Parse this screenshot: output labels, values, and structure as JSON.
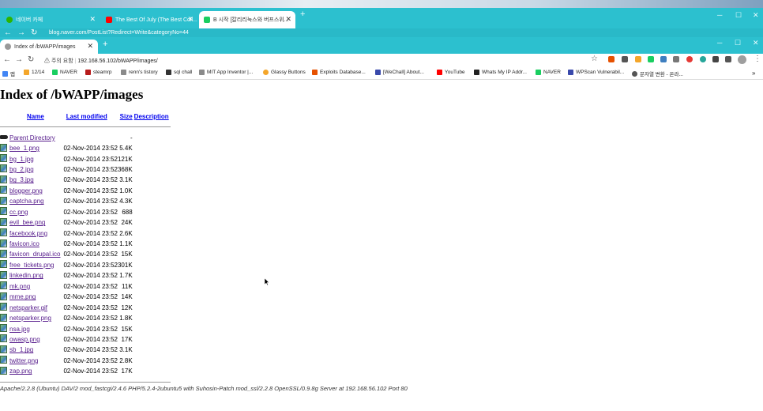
{
  "back_window": {
    "tabs": [
      {
        "title": "네이버 카페",
        "color": "#2db400"
      },
      {
        "title": "The Best Of July (The Best Coll...",
        "color": "#ff0000"
      },
      {
        "title": "B 시작 [칼리리눅스와 버프스위...",
        "color": "#19ce60"
      }
    ],
    "url": "blog.naver.com/PostList?Redirect=Write&categoryNo=44"
  },
  "front_window": {
    "tab_title": "Index of /bWAPP/images",
    "url_warning": "주의 요함",
    "url": "192.168.56.102/bWAPP/images/",
    "bookmarks": [
      {
        "label": "앱",
        "color": "#4285f4"
      },
      {
        "label": "12/14",
        "color": "#f4a62a"
      },
      {
        "label": "NAVER",
        "color": "#19ce60"
      },
      {
        "label": "steamrp",
        "color": "#b71c1c"
      },
      {
        "label": "renn's tistory",
        "color": "#8a8a8a"
      },
      {
        "label": "sql chall",
        "color": "#333333"
      },
      {
        "label": "MIT App Inventor |...",
        "color": "#8a8a8a"
      },
      {
        "label": "Glassy Buttons",
        "color": "#f4a62a"
      },
      {
        "label": "Exploits Database...",
        "color": "#e65100"
      },
      {
        "label": "[WeChall] About...",
        "color": "#3949ab"
      },
      {
        "label": "YouTube",
        "color": "#ff0000"
      },
      {
        "label": "Whats My IP Addr...",
        "color": "#222222"
      },
      {
        "label": "NAVER",
        "color": "#19ce60"
      },
      {
        "label": "WPScan Vulnerabil...",
        "color": "#3949ab"
      },
      {
        "label": "문자열 변환 - 온라...",
        "color": "#555555"
      }
    ]
  },
  "page": {
    "title": "Index of /bWAPP/images",
    "headers": {
      "name": "Name",
      "modified": "Last modified",
      "size": "Size",
      "description": "Description"
    },
    "parent": {
      "name": "Parent Directory",
      "size": "-"
    },
    "files": [
      {
        "name": "bee_1.png",
        "modified": "02-Nov-2014 23:52",
        "size": "5.4K"
      },
      {
        "name": "bg_1.jpg",
        "modified": "02-Nov-2014 23:52",
        "size": "121K"
      },
      {
        "name": "bg_2.jpg",
        "modified": "02-Nov-2014 23:52",
        "size": "368K"
      },
      {
        "name": "bg_3.jpg",
        "modified": "02-Nov-2014 23:52",
        "size": "3.1K"
      },
      {
        "name": "blogger.png",
        "modified": "02-Nov-2014 23:52",
        "size": "1.0K"
      },
      {
        "name": "captcha.png",
        "modified": "02-Nov-2014 23:52",
        "size": "4.3K"
      },
      {
        "name": "cc.png",
        "modified": "02-Nov-2014 23:52",
        "size": "688"
      },
      {
        "name": "evil_bee.png",
        "modified": "02-Nov-2014 23:52",
        "size": "24K"
      },
      {
        "name": "facebook.png",
        "modified": "02-Nov-2014 23:52",
        "size": "2.6K"
      },
      {
        "name": "favicon.ico",
        "modified": "02-Nov-2014 23:52",
        "size": "1.1K"
      },
      {
        "name": "favicon_drupal.ico",
        "modified": "02-Nov-2014 23:52",
        "size": "15K"
      },
      {
        "name": "free_tickets.png",
        "modified": "02-Nov-2014 23:52",
        "size": "301K"
      },
      {
        "name": "linkedin.png",
        "modified": "02-Nov-2014 23:52",
        "size": "1.7K"
      },
      {
        "name": "mk.png",
        "modified": "02-Nov-2014 23:52",
        "size": "11K"
      },
      {
        "name": "mme.png",
        "modified": "02-Nov-2014 23:52",
        "size": "14K"
      },
      {
        "name": "netsparker.gif",
        "modified": "02-Nov-2014 23:52",
        "size": "12K"
      },
      {
        "name": "netsparker.png",
        "modified": "02-Nov-2014 23:52",
        "size": "1.8K"
      },
      {
        "name": "nsa.jpg",
        "modified": "02-Nov-2014 23:52",
        "size": "15K"
      },
      {
        "name": "owasp.png",
        "modified": "02-Nov-2014 23:52",
        "size": "17K"
      },
      {
        "name": "sb_1.jpg",
        "modified": "02-Nov-2014 23:52",
        "size": "3.1K"
      },
      {
        "name": "twitter.png",
        "modified": "02-Nov-2014 23:52",
        "size": "2.8K"
      },
      {
        "name": "zap.png",
        "modified": "02-Nov-2014 23:52",
        "size": "17K"
      }
    ],
    "footer": "Apache/2.2.8 (Ubuntu) DAV/2 mod_fastcgi/2.4.6 PHP/5.2.4-2ubuntu5 with Suhosin-Patch mod_ssl/2.2.8 OpenSSL/0.9.8g Server at 192.168.56.102 Port 80"
  }
}
